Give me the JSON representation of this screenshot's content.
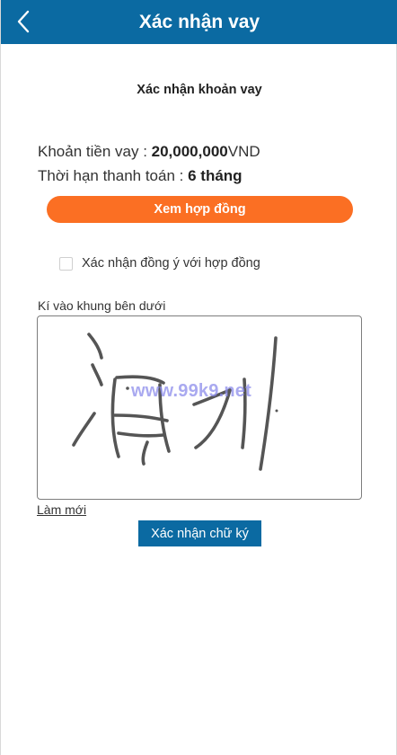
{
  "header": {
    "title": "Xác nhận vay",
    "back_icon": "chevron-left-icon"
  },
  "page": {
    "subtitle": "Xác nhận khoản vay"
  },
  "loan": {
    "amount_label": "Khoản tiền vay : ",
    "amount_value": "20,000,000",
    "amount_unit": "VND",
    "term_label": "Thời hạn thanh toán : ",
    "term_value": "6 tháng"
  },
  "actions": {
    "view_contract": "Xem hợp đồng",
    "agree_label": "Xác nhận đồng ý với hợp đồng",
    "agree_checked": false,
    "signature_label": "Kí vào khung bên dưới",
    "reset": "Làm mới",
    "confirm_signature": "Xác nhận chữ ký"
  },
  "overlay": {
    "watermark": "www.99k9.net"
  },
  "colors": {
    "primary": "#0b6aa2",
    "accent": "#fb6f23",
    "signature_ink": "#555555",
    "watermark": "#8c8ceb"
  }
}
